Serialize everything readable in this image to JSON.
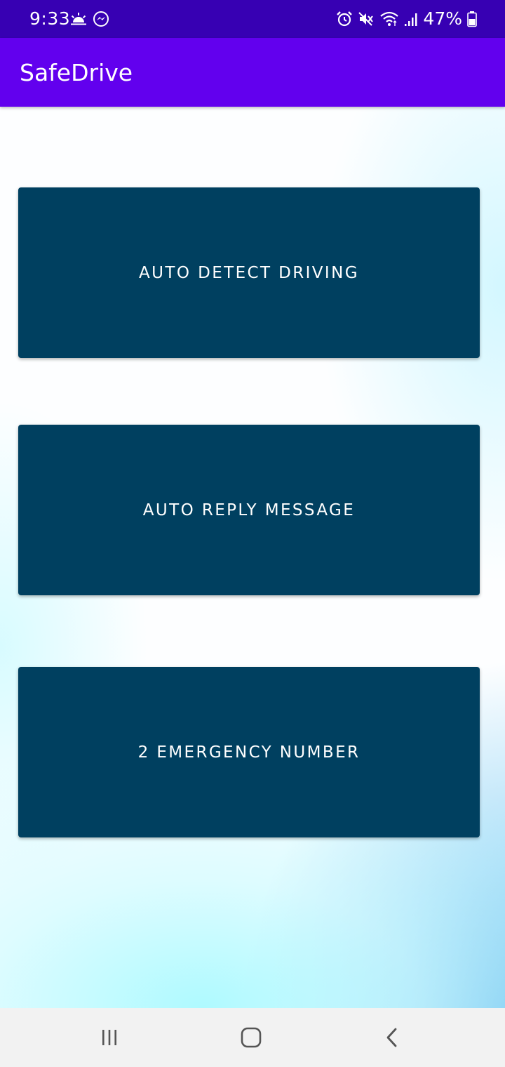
{
  "status_bar": {
    "time": "9:33",
    "battery_percent": "47%",
    "left_icons": [
      "weather-sunrise-icon",
      "messenger-icon"
    ],
    "right_icons": [
      "alarm-icon",
      "mute-icon",
      "wifi-icon",
      "signal-icon",
      "battery-icon"
    ],
    "background_color": "#3700b3"
  },
  "app_bar": {
    "title": "SafeDrive",
    "background_color": "#6200ee"
  },
  "main": {
    "buttons": [
      {
        "label": "AUTO DETECT DRIVING"
      },
      {
        "label": "AUTO REPLY MESSAGE"
      },
      {
        "label": "2 EMERGENCY NUMBER"
      }
    ],
    "button_color": "#004060"
  },
  "nav_bar": {
    "items": [
      "recent-apps-icon",
      "home-icon",
      "back-icon"
    ]
  }
}
